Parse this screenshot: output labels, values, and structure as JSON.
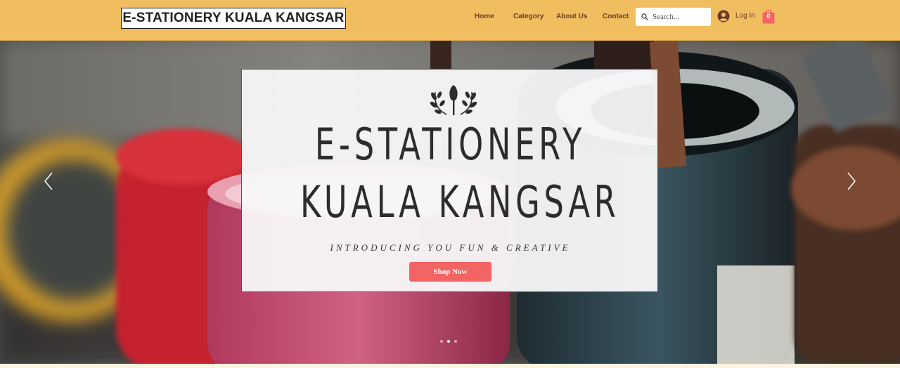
{
  "site": {
    "logo_text": "E-STATIONERY KUALA KANGSAR"
  },
  "nav": {
    "items": [
      {
        "label": "Home"
      },
      {
        "label": "Category"
      },
      {
        "label": "About Us"
      },
      {
        "label": "Contact"
      }
    ]
  },
  "search": {
    "placeholder": "Search..."
  },
  "account": {
    "login_label": "Log In",
    "cart_count": "0"
  },
  "hero": {
    "title_line1": "E-STATIONERY",
    "title_line2": "KUALA KANGSAR",
    "subtitle": "INTRODUCING YOU FUN & CREATIVE",
    "cta_label": "Shop Now",
    "slides_total": 3,
    "active_slide": 1
  },
  "icons": [
    "search-icon",
    "user-icon",
    "cart-icon",
    "shovel-emblem-icon",
    "chevron-left-icon",
    "chevron-right-icon"
  ],
  "colors": {
    "header_bg": "#f0be5e",
    "nav_text": "#6b3c2a",
    "cta_bg": "#f36464",
    "cart": "#f36464"
  }
}
